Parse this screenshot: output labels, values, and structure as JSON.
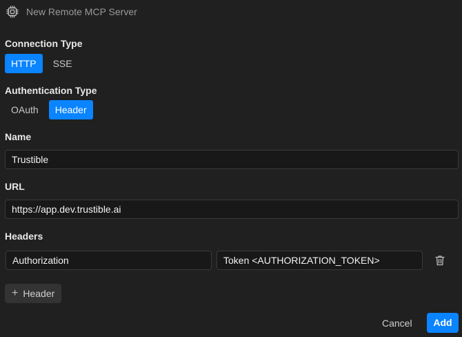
{
  "window": {
    "title": "New Remote MCP Server",
    "icon": "chip-icon"
  },
  "connection": {
    "label": "Connection Type",
    "options": [
      "HTTP",
      "SSE"
    ],
    "selected": "HTTP"
  },
  "auth": {
    "label": "Authentication Type",
    "options": [
      "OAuth",
      "Header"
    ],
    "selected": "Header"
  },
  "name": {
    "label": "Name",
    "value": "Trustible"
  },
  "url": {
    "label": "URL",
    "value": "https://app.dev.trustible.ai"
  },
  "headers": {
    "label": "Headers",
    "rows": [
      {
        "key": "Authorization",
        "value": "Token <AUTHORIZATION_TOKEN>"
      }
    ],
    "add_label": "Header",
    "delete_icon": "trash-icon"
  },
  "actions": {
    "cancel_label": "Cancel",
    "add_label": "Add"
  },
  "colors": {
    "accent": "#0a84ff",
    "background": "#202020"
  }
}
